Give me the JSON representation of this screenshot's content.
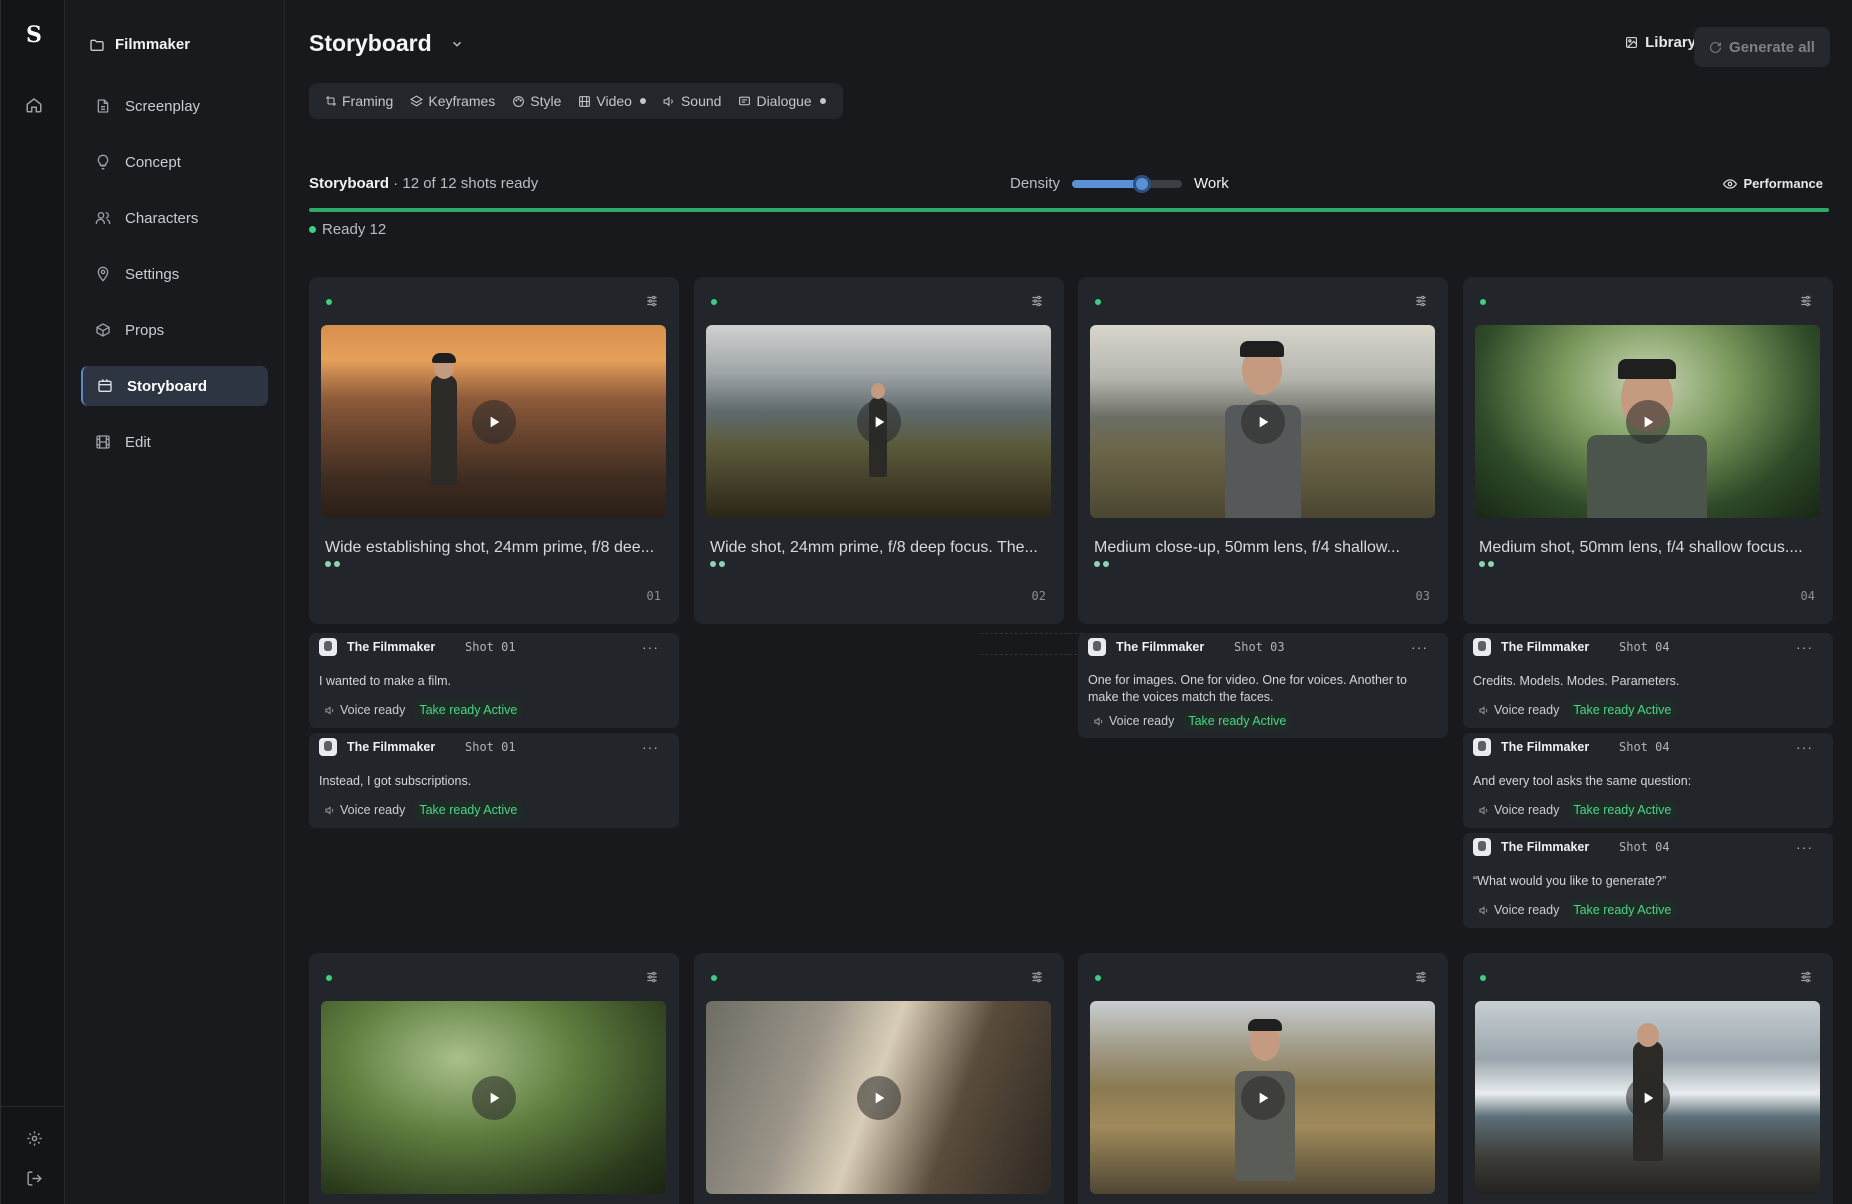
{
  "app": {
    "logo": "S",
    "project": "Filmmaker"
  },
  "sidebar": {
    "items": [
      {
        "label": "Screenplay",
        "icon": "document-icon"
      },
      {
        "label": "Concept",
        "icon": "lightbulb-icon"
      },
      {
        "label": "Characters",
        "icon": "users-icon"
      },
      {
        "label": "Settings",
        "icon": "map-pin-icon"
      },
      {
        "label": "Props",
        "icon": "box-icon"
      },
      {
        "label": "Storyboard",
        "icon": "storyboard-icon",
        "active": true
      },
      {
        "label": "Edit",
        "icon": "film-icon"
      }
    ]
  },
  "header": {
    "title": "Storyboard",
    "library_label": "Library",
    "generate_label": "Generate all"
  },
  "tabs": [
    {
      "label": "Framing",
      "dot": false
    },
    {
      "label": "Keyframes",
      "dot": false
    },
    {
      "label": "Style",
      "dot": false
    },
    {
      "label": "Video",
      "dot": true
    },
    {
      "label": "Sound",
      "dot": false
    },
    {
      "label": "Dialogue",
      "dot": true
    }
  ],
  "status": {
    "label": "Storyboard",
    "summary": " · 12 of 12 shots ready",
    "density_label": "Density",
    "density_value": 0.64,
    "density_mode": "Work",
    "performance_label": "Performance",
    "progress": 1.0,
    "ready_label": "Ready 12"
  },
  "colors": {
    "accent": "#5b8fd6",
    "ready": "#3ecf7f",
    "take_ready": "#4cd38a"
  },
  "shots": [
    {
      "number": "01",
      "desc": "Wide establishing shot, 24mm prime, f/8 dee..."
    },
    {
      "number": "02",
      "desc": "Wide shot, 24mm prime, f/8 deep focus. The..."
    },
    {
      "number": "03",
      "desc": "Medium close-up, 50mm lens, f/4 shallow..."
    },
    {
      "number": "04",
      "desc": "Medium shot, 50mm lens, f/4 shallow focus...."
    }
  ],
  "dialogue": {
    "shot01": [
      {
        "speaker": "The Filmmaker",
        "shot": "Shot 01",
        "line": "I wanted to make a film.",
        "voice": "Voice ready",
        "take": "Take ready Active"
      },
      {
        "speaker": "The Filmmaker",
        "shot": "Shot 01",
        "line": "Instead, I got subscriptions.",
        "voice": "Voice ready",
        "take": "Take ready Active"
      }
    ],
    "shot03": [
      {
        "speaker": "The Filmmaker",
        "shot": "Shot 03",
        "line": "One for images. One for video. One for voices. Another to make the voices match the faces.",
        "voice": "Voice ready",
        "take": "Take ready Active"
      }
    ],
    "shot04": [
      {
        "speaker": "The Filmmaker",
        "shot": "Shot 04",
        "line": "Credits. Models. Modes. Parameters.",
        "voice": "Voice ready",
        "take": "Take ready Active"
      },
      {
        "speaker": "The Filmmaker",
        "shot": "Shot 04",
        "line": "And every tool asks the same question:",
        "voice": "Voice ready",
        "take": "Take ready Active"
      },
      {
        "speaker": "The Filmmaker",
        "shot": "Shot 04",
        "line": "“What would you like to generate?”",
        "voice": "Voice ready",
        "take": "Take ready Active"
      }
    ]
  }
}
